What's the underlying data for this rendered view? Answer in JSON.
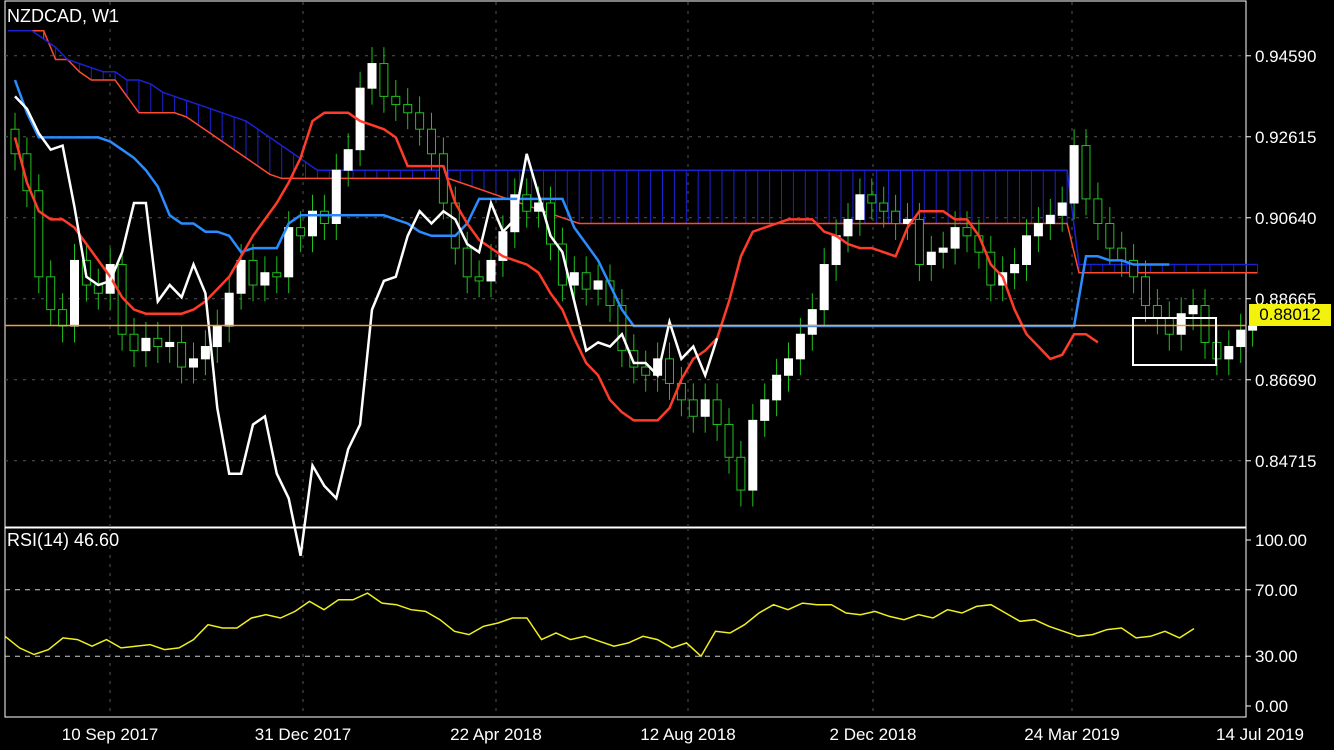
{
  "header": {
    "title": "NZDCAD, W1"
  },
  "rsi_header": {
    "label": "RSI(14)",
    "value": "46.60"
  },
  "current_price": {
    "label": "0.88012",
    "value": 0.88012,
    "color": "#f2f20c"
  },
  "colors": {
    "background": "#000000",
    "bull_candle": "#ffffff",
    "candle_wick": "#22c01e",
    "tenkan": "#ff3b2a",
    "kijun": "#2a8cff",
    "chikou": "#ffffff",
    "span_a": "#ff4a2e",
    "span_b": "#1a22d0",
    "rsi": "#f0f020",
    "price_line": "#f0a040"
  },
  "chart_data": [
    {
      "type": "candlestick",
      "title": "NZDCAD, W1",
      "indicators": [
        "Ichimoku Kinko Hyo",
        "Current price line"
      ],
      "y_ticks": [
        "0.94590",
        "0.92615",
        "0.90640",
        "0.88665",
        "0.86690",
        "0.84715"
      ],
      "ylim": [
        0.831,
        0.9595
      ],
      "x_ticks": [
        "10 Sep 2017",
        "31 Dec 2017",
        "22 Apr 2018",
        "12 Aug 2018",
        "2 Dec 2018",
        "24 Mar 2019",
        "14 Jul 2019"
      ],
      "grid": true,
      "close": [
        0.922,
        0.913,
        0.892,
        0.884,
        0.88,
        0.896,
        0.89,
        0.888,
        0.895,
        0.878,
        0.874,
        0.877,
        0.875,
        0.876,
        0.87,
        0.872,
        0.875,
        0.88,
        0.888,
        0.896,
        0.89,
        0.893,
        0.892,
        0.904,
        0.902,
        0.908,
        0.905,
        0.918,
        0.923,
        0.938,
        0.944,
        0.936,
        0.934,
        0.932,
        0.928,
        0.922,
        0.91,
        0.899,
        0.892,
        0.891,
        0.896,
        0.903,
        0.912,
        0.908,
        0.91,
        0.9,
        0.89,
        0.893,
        0.889,
        0.891,
        0.885,
        0.874,
        0.87,
        0.868,
        0.872,
        0.866,
        0.862,
        0.858,
        0.862,
        0.856,
        0.848,
        0.84,
        0.857,
        0.862,
        0.868,
        0.872,
        0.878,
        0.884,
        0.895,
        0.902,
        0.906,
        0.912,
        0.91,
        0.908,
        0.905,
        0.906,
        0.895,
        0.898,
        0.899,
        0.904,
        0.902,
        0.898,
        0.89,
        0.893,
        0.895,
        0.902,
        0.905,
        0.907,
        0.91,
        0.924,
        0.911,
        0.905,
        0.899,
        0.896,
        0.892,
        0.885,
        0.882,
        0.878,
        0.883,
        0.885,
        0.876,
        0.872,
        0.875,
        0.879,
        0.88
      ],
      "series": [
        {
          "name": "Tenkan-sen",
          "values": [
            0.926,
            0.915,
            0.908,
            0.906,
            0.906,
            0.904,
            0.9,
            0.896,
            0.892,
            0.887,
            0.884,
            0.883,
            0.883,
            0.883,
            0.883,
            0.884,
            0.886,
            0.889,
            0.892,
            0.897,
            0.902,
            0.906,
            0.91,
            0.915,
            0.921,
            0.93,
            0.932,
            0.932,
            0.932,
            0.93,
            0.929,
            0.928,
            0.926,
            0.919,
            0.919,
            0.919,
            0.919,
            0.91,
            0.905,
            0.901,
            0.899,
            0.897,
            0.896,
            0.895,
            0.893,
            0.888,
            0.884,
            0.877,
            0.871,
            0.868,
            0.862,
            0.859,
            0.857,
            0.857,
            0.857,
            0.86,
            0.867,
            0.872,
            0.874,
            0.877,
            0.886,
            0.897,
            0.903,
            0.904,
            0.905,
            0.906,
            0.906,
            0.906,
            0.903,
            0.902,
            0.9,
            0.899,
            0.899,
            0.898,
            0.897,
            0.904,
            0.908,
            0.908,
            0.908,
            0.906,
            0.906,
            0.902,
            0.895,
            0.892,
            0.884,
            0.878,
            0.875,
            0.872,
            0.873,
            0.878,
            0.878,
            0.876
          ]
        },
        {
          "name": "Kijun-sen",
          "values": [
            0.94,
            0.932,
            0.926,
            0.926,
            0.926,
            0.926,
            0.926,
            0.926,
            0.925,
            0.923,
            0.921,
            0.918,
            0.914,
            0.907,
            0.905,
            0.905,
            0.903,
            0.903,
            0.902,
            0.898,
            0.899,
            0.899,
            0.899,
            0.905,
            0.907,
            0.907,
            0.907,
            0.907,
            0.907,
            0.907,
            0.907,
            0.907,
            0.906,
            0.905,
            0.903,
            0.902,
            0.902,
            0.902,
            0.905,
            0.911,
            0.911,
            0.911,
            0.911,
            0.911,
            0.911,
            0.911,
            0.911,
            0.904,
            0.9,
            0.896,
            0.89,
            0.884,
            0.88,
            0.88,
            0.88,
            0.88,
            0.88,
            0.88,
            0.88,
            0.88,
            0.88,
            0.88,
            0.88,
            0.88,
            0.88,
            0.88,
            0.88,
            0.88,
            0.88,
            0.88,
            0.88,
            0.88,
            0.88,
            0.88,
            0.88,
            0.88,
            0.88,
            0.88,
            0.88,
            0.88,
            0.88,
            0.88,
            0.88,
            0.88,
            0.88,
            0.88,
            0.88,
            0.88,
            0.88,
            0.88,
            0.897,
            0.897,
            0.896,
            0.896,
            0.895,
            0.895,
            0.895,
            0.895
          ]
        },
        {
          "name": "Chikou Span",
          "values": [
            0.936,
            0.933,
            0.927,
            0.923,
            0.924,
            0.909,
            0.892,
            0.89,
            0.891,
            0.898,
            0.91,
            0.91,
            0.886,
            0.89,
            0.887,
            0.895,
            0.888,
            0.86,
            0.844,
            0.844,
            0.856,
            0.858,
            0.844,
            0.838,
            0.824,
            0.846,
            0.841,
            0.838,
            0.85,
            0.856,
            0.884,
            0.891,
            0.892,
            0.902,
            0.908,
            0.905,
            0.908,
            0.906,
            0.9,
            0.898,
            0.91,
            0.903,
            0.906,
            0.922,
            0.912,
            0.902,
            0.898,
            0.886,
            0.874,
            0.876,
            0.875,
            0.878,
            0.871,
            0.871,
            0.868,
            0.881,
            0.872,
            0.875,
            0.868,
            0.877
          ]
        },
        {
          "name": "Senkou Span A",
          "values": [
            0.952,
            0.952,
            0.952,
            0.952,
            0.945,
            0.945,
            0.942,
            0.94,
            0.94,
            0.94,
            0.936,
            0.932,
            0.932,
            0.932,
            0.932,
            0.931,
            0.929,
            0.927,
            0.925,
            0.923,
            0.921,
            0.919,
            0.917,
            0.916,
            0.916,
            0.916,
            0.916,
            0.916,
            0.916,
            0.916,
            0.916,
            0.916,
            0.916,
            0.916,
            0.916,
            0.916,
            0.916,
            0.916,
            0.915,
            0.914,
            0.913,
            0.912,
            0.911,
            0.91,
            0.909,
            0.908,
            0.907,
            0.906,
            0.905,
            0.905,
            0.905,
            0.905,
            0.905,
            0.905,
            0.905,
            0.905,
            0.905,
            0.905,
            0.905,
            0.905,
            0.905,
            0.905,
            0.905,
            0.905,
            0.905,
            0.905,
            0.905,
            0.905,
            0.905,
            0.905,
            0.905,
            0.905,
            0.905,
            0.905,
            0.905,
            0.905,
            0.905,
            0.905,
            0.905,
            0.905,
            0.905,
            0.905,
            0.905,
            0.905,
            0.905,
            0.905,
            0.905,
            0.905,
            0.905,
            0.905,
            0.893,
            0.893,
            0.893,
            0.893,
            0.893,
            0.893,
            0.893,
            0.893,
            0.893,
            0.893,
            0.893,
            0.893,
            0.893,
            0.893,
            0.893,
            0.893
          ]
        },
        {
          "name": "Senkou Span B",
          "values": [
            0.952,
            0.952,
            0.952,
            0.95,
            0.948,
            0.945,
            0.944,
            0.943,
            0.942,
            0.942,
            0.94,
            0.94,
            0.939,
            0.937,
            0.936,
            0.935,
            0.934,
            0.933,
            0.932,
            0.931,
            0.93,
            0.928,
            0.926,
            0.924,
            0.922,
            0.92,
            0.918,
            0.918,
            0.918,
            0.918,
            0.918,
            0.918,
            0.918,
            0.918,
            0.918,
            0.918,
            0.918,
            0.918,
            0.918,
            0.918,
            0.918,
            0.918,
            0.918,
            0.918,
            0.918,
            0.918,
            0.918,
            0.918,
            0.918,
            0.918,
            0.918,
            0.918,
            0.918,
            0.918,
            0.918,
            0.918,
            0.918,
            0.918,
            0.918,
            0.918,
            0.918,
            0.918,
            0.918,
            0.918,
            0.918,
            0.918,
            0.918,
            0.918,
            0.918,
            0.918,
            0.918,
            0.918,
            0.918,
            0.918,
            0.918,
            0.918,
            0.918,
            0.918,
            0.918,
            0.918,
            0.918,
            0.918,
            0.918,
            0.918,
            0.918,
            0.918,
            0.918,
            0.918,
            0.918,
            0.918,
            0.895,
            0.895,
            0.895,
            0.895,
            0.895,
            0.895,
            0.895,
            0.895,
            0.895,
            0.895,
            0.895,
            0.895,
            0.895,
            0.895,
            0.895,
            0.895
          ]
        }
      ],
      "current_price": 0.88012
    },
    {
      "type": "line",
      "title": "RSI(14) 46.60",
      "ylim": [
        0,
        100
      ],
      "y_ticks": [
        "100.00",
        "70.00",
        "30.00",
        "0.00"
      ],
      "levels": [
        70,
        30
      ],
      "series": [
        {
          "name": "RSI(14)",
          "values": [
            42,
            35,
            31,
            34,
            41,
            40,
            36,
            40,
            35,
            36,
            37,
            34,
            35,
            40,
            49,
            47,
            47,
            53,
            55,
            53,
            57,
            63,
            58,
            64,
            64,
            68,
            62,
            61,
            58,
            57,
            52,
            45,
            43,
            48,
            50,
            53,
            53,
            40,
            44,
            40,
            42,
            39,
            36,
            38,
            42,
            40,
            35,
            38,
            30,
            45,
            44,
            49,
            56,
            61,
            58,
            62,
            61,
            61,
            56,
            55,
            57,
            54,
            52,
            55,
            53,
            58,
            56,
            60,
            61,
            56,
            51,
            52,
            48,
            45,
            42,
            43,
            46,
            47,
            41,
            42,
            45,
            41,
            46.6
          ]
        }
      ]
    }
  ]
}
